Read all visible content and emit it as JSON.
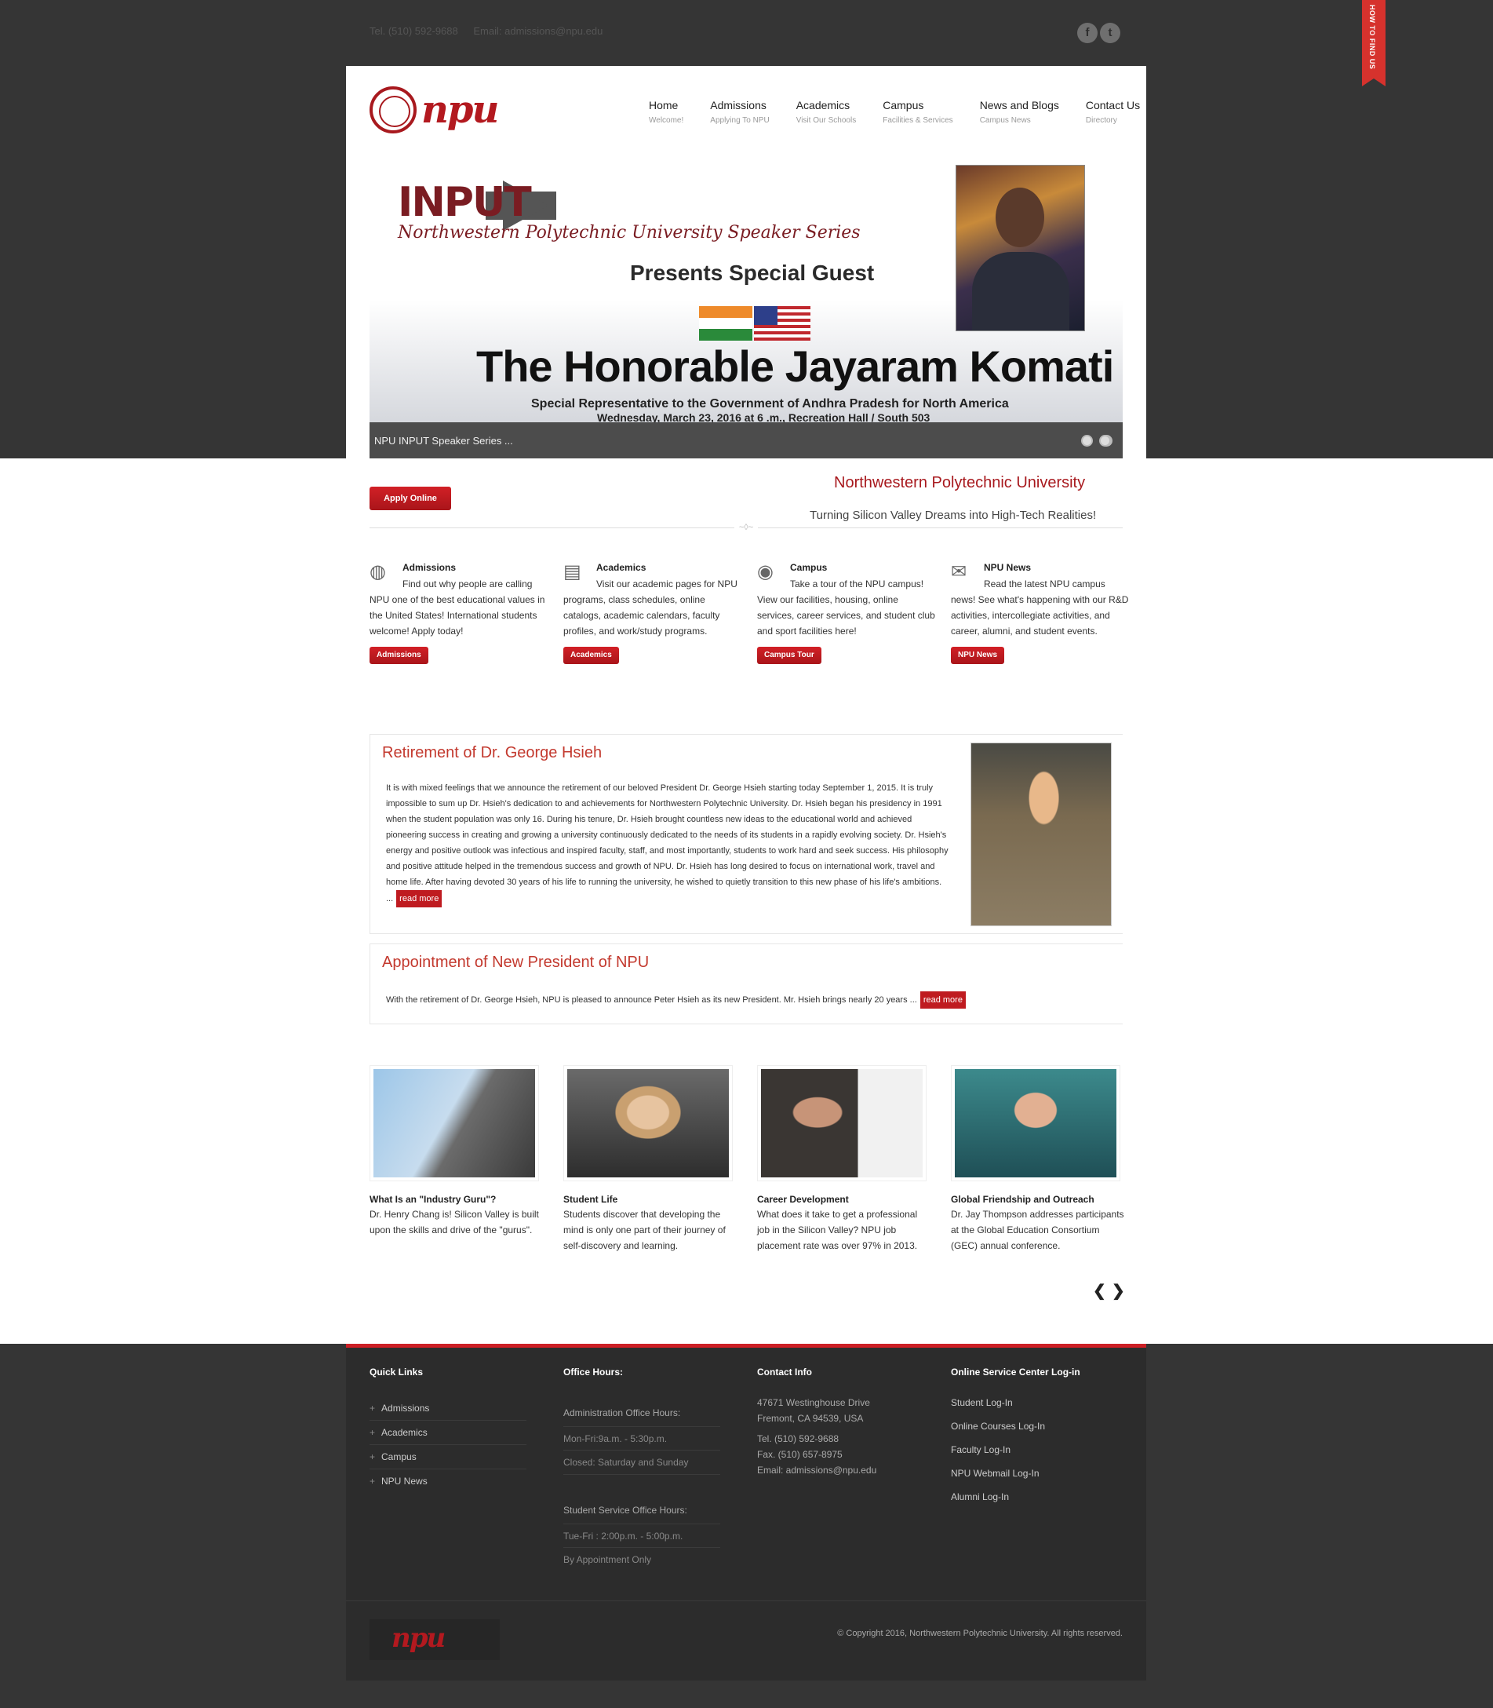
{
  "topbar": {
    "tel": "Tel. (510) 592-9688",
    "email": "Email: admissions@npu.edu",
    "ribbon": "HOW TO FIND US"
  },
  "logo": {
    "text": "npu"
  },
  "nav": [
    {
      "label": "Home",
      "sub": "Welcome!"
    },
    {
      "label": "Admissions",
      "sub": "Applying To NPU"
    },
    {
      "label": "Academics",
      "sub": "Visit Our Schools"
    },
    {
      "label": "Campus",
      "sub": "Facilities & Services"
    },
    {
      "label": "News and Blogs",
      "sub": "Campus News"
    },
    {
      "label": "Contact Us",
      "sub": "Directory"
    }
  ],
  "slider": {
    "input_word": "INPUT",
    "series": "Northwestern Polytechnic University Speaker Series",
    "presents": "Presents Special Guest",
    "guest_name": "The Honorable Jayaram Komati",
    "guest_role": "Special Representative to the Government of Andhra Pradesh for North America",
    "guest_date": "Wednesday, March 23, 2016 at 6 .m., Recreation Hall / South 503",
    "caption": "NPU INPUT Speaker Series ..."
  },
  "intro": {
    "apply_button": "Apply Online",
    "title": "Northwestern Polytechnic University",
    "tagline": "Turning Silicon Valley Dreams into High-Tech Realities!"
  },
  "features": [
    {
      "icon": "globe-icon",
      "title": "Admissions",
      "desc": "Find out why people are calling NPU one of the best educational values in the United States! International students welcome! Apply today!",
      "button": "Admissions"
    },
    {
      "icon": "notebook-icon",
      "title": "Academics",
      "desc": "Visit our academic pages for NPU programs, class schedules, online catalogs, academic calendars, faculty profiles, and work/study programs.",
      "button": "Academics"
    },
    {
      "icon": "eye-icon",
      "title": "Campus",
      "desc": "Take a tour of the NPU campus! View our facilities, housing, online services, career services, and student club and sport facilities here!",
      "button": "Campus Tour"
    },
    {
      "icon": "envelope-icon",
      "title": "NPU News",
      "desc": "Read the latest NPU campus news! See what's happening with our R&D activities, intercollegiate activities, and career, alumni, and student events.",
      "button": "NPU News"
    }
  ],
  "news": [
    {
      "title": "Retirement of Dr. George Hsieh",
      "body": "It is with mixed feelings that we announce the retirement of our beloved President Dr. George Hsieh starting today September 1, 2015. It is truly impossible to sum up Dr. Hsieh's dedication to and achievements for Northwestern Polytechnic University. Dr. Hsieh began his presidency in 1991 when the student population was only 16. During his tenure, Dr. Hsieh brought countless new ideas to the educational world and achieved pioneering success in creating and growing a university continuously dedicated to the needs of its students in a rapidly evolving society. Dr. Hsieh's energy and positive outlook was infectious and inspired faculty, staff, and most importantly, students to work hard and seek success. His philosophy and positive attitude helped in the tremendous success and growth of NPU. Dr. Hsieh has long desired to focus on international work, travel and home life. After having devoted 30 years of his life to running the university, he wished to quietly transition to this new phase of his life's ambitions. ...",
      "read_more": "read more"
    },
    {
      "title": "Appointment of New President of NPU",
      "body": "With the retirement of Dr. George Hsieh, NPU is pleased to announce Peter Hsieh as its new President. Mr. Hsieh brings nearly 20 years ...",
      "read_more": "read more"
    }
  ],
  "gallery": [
    {
      "title": "What Is an \"Industry Guru\"?",
      "desc": "Dr. Henry Chang is! Silicon Valley is built upon the skills and drive of the \"gurus\"."
    },
    {
      "title": "Student Life",
      "desc": "Students discover that developing the mind is only one part of their journey of self-discovery and learning."
    },
    {
      "title": "Career Development",
      "desc": "What does it take to get a professional job in the Silicon Valley? NPU job placement rate was over 97% in 2013."
    },
    {
      "title": "Global Friendship and Outreach",
      "desc": "Dr. Jay Thompson addresses participants at the Global Education Consortium (GEC) annual conference."
    }
  ],
  "footer": {
    "quick_links_title": "Quick Links",
    "quick_links": [
      "Admissions",
      "Academics",
      "Campus",
      "NPU News"
    ],
    "office_hours_title": "Office Hours:",
    "admin_hours_label": "Administration Office Hours:",
    "admin_hours": [
      "Mon-Fri:9a.m. - 5:30p.m.",
      "Closed: Saturday and Sunday"
    ],
    "student_hours_label": "Student Service Office Hours:",
    "student_hours": [
      "Tue-Fri : 2:00p.m. - 5:00p.m.",
      "By Appointment Only"
    ],
    "contact_title": "Contact Info",
    "address1": "47671 Westinghouse Drive",
    "address2": "Fremont, CA 94539, USA",
    "tel": "Tel. (510) 592-9688",
    "fax": "Fax. (510) 657-8975",
    "email": "Email: admissions@npu.edu",
    "online_title": "Online Service Center Log-in",
    "online_links": [
      "Student Log-In",
      "Online Courses Log-In",
      "Faculty Log-In",
      "NPU Webmail Log-In",
      "Alumni Log-In"
    ],
    "copyright": "© Copyright 2016, Northwestern Polytechnic University. All rights reserved."
  }
}
